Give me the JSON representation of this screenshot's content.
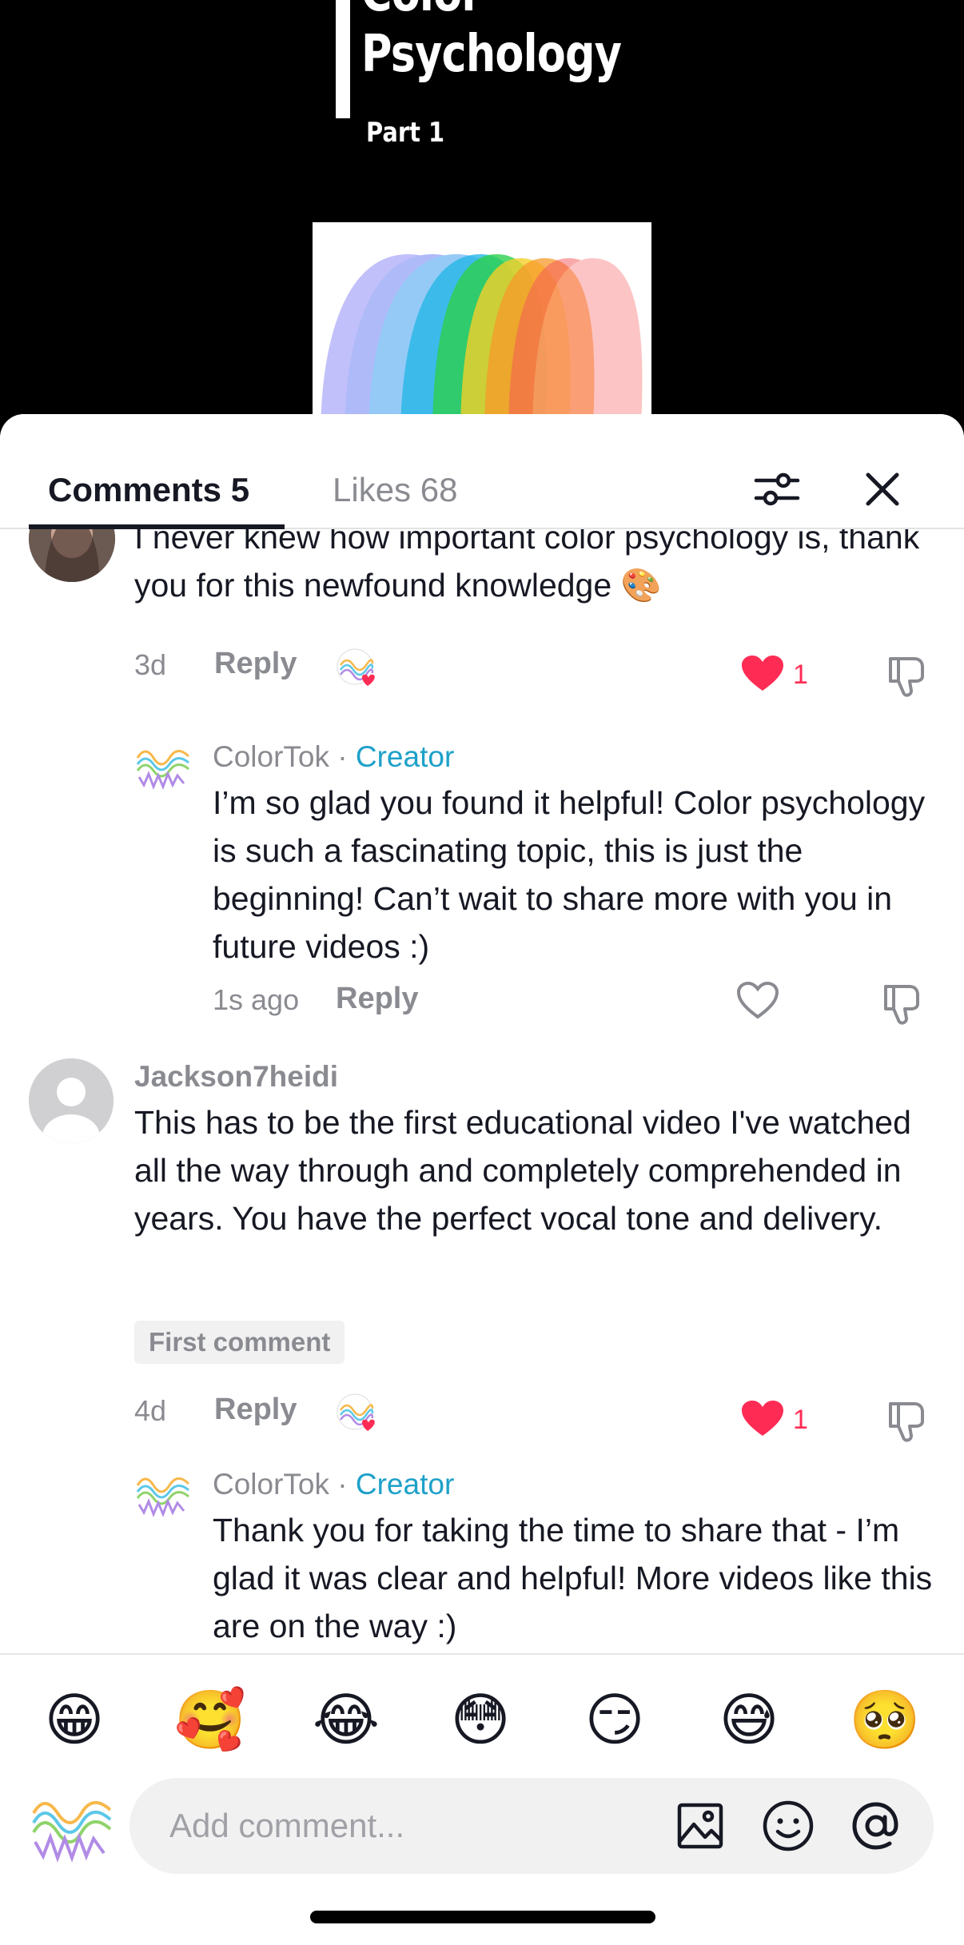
{
  "video": {
    "title_partial": "Color",
    "title": "Psychology",
    "part": "Part 1"
  },
  "tabs": {
    "comments_label": "Comments 5",
    "likes_label": "Likes 68"
  },
  "comments": [
    {
      "text": "I never knew how important color psychology is, thank you for this newfound knowledge 🎨",
      "age": "3d",
      "reply_label": "Reply",
      "like_count": "1",
      "reply": {
        "username": "ColorTok",
        "separator": " · ",
        "role": "Creator",
        "text": "I’m so glad you found it helpful! Color psychology is such a fascinating topic, this is just the beginning! Can’t wait to share more with you in future videos :)",
        "age": "1s ago",
        "reply_label": "Reply"
      }
    },
    {
      "username": "Jackson7heidi",
      "text": "This has to be the first educational video I've watched all the way through and completely comprehended in years. You have the perfect vocal tone and delivery.",
      "badge": "First comment",
      "age": "4d",
      "reply_label": "Reply",
      "like_count": "1",
      "reply": {
        "username": "ColorTok",
        "separator": " · ",
        "role": "Creator",
        "text": "Thank you for taking the time to share that - I’m glad it was clear and helpful! More videos like this are on the way :)"
      }
    }
  ],
  "emojis": [
    "😁",
    "🥰",
    "😂",
    "😳",
    "😏",
    "😅",
    "🥺"
  ],
  "composer": {
    "placeholder": "Add comment..."
  },
  "colors": {
    "accent_red": "#fe2c55",
    "creator_blue": "#1da1c9",
    "text_primary": "#161823",
    "text_secondary": "#8a8b91"
  }
}
